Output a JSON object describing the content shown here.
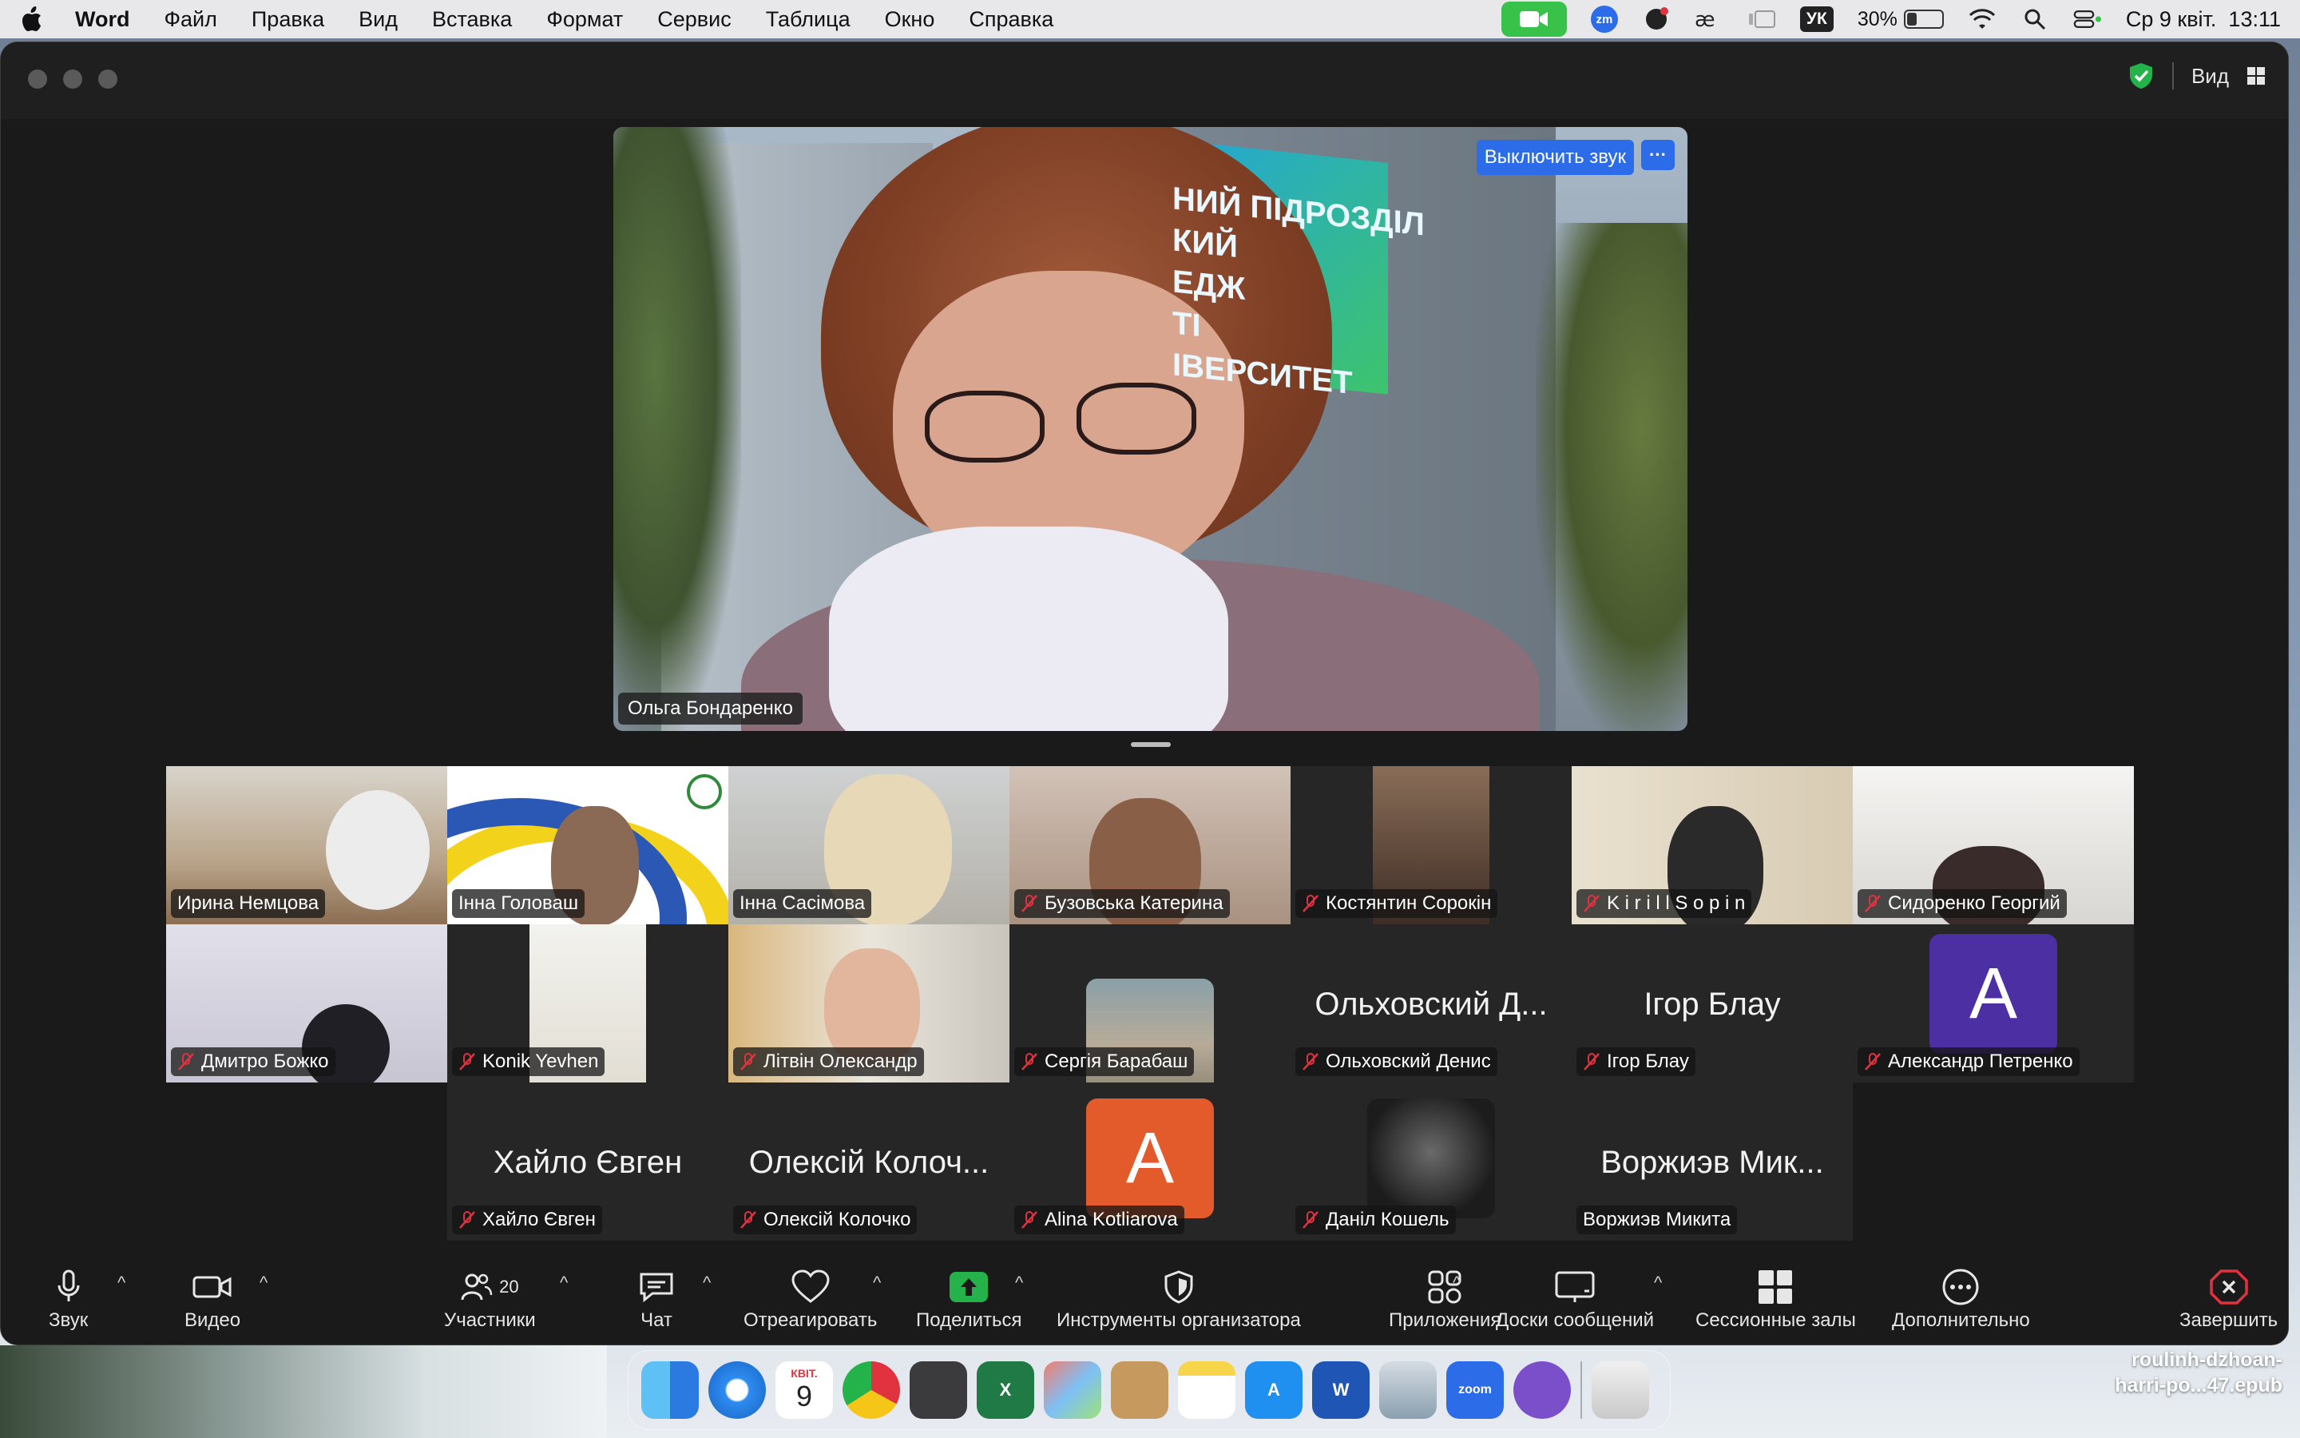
{
  "menubar": {
    "app": "Word",
    "items": [
      "Файл",
      "Правка",
      "Вид",
      "Вставка",
      "Формат",
      "Сервис",
      "Таблица",
      "Окно",
      "Справка"
    ],
    "zoom_badge": "zm",
    "lang": "УК",
    "battery": "30%",
    "battery_level": 0.3,
    "datetime": "Ср 9 квіт.  13:11"
  },
  "zoom": {
    "view_label": "Вид",
    "speaker": {
      "name": "Ольга Бондаренко",
      "mute_label": "Выключить звук",
      "more_label": "···",
      "sign_text": "НИЙ ПІДРОЗДІЛ\nКИЙ\nЕДЖ\nТІ\nІВЕРСИТЕТ"
    },
    "participants": [
      {
        "name": "Ирина Немцова",
        "muted": false
      },
      {
        "name": "Інна Головаш",
        "muted": false
      },
      {
        "name": "Інна Сасімова",
        "muted": false
      },
      {
        "name": "Бузовська Катерина",
        "muted": true
      },
      {
        "name": "Костянтин Сорокін",
        "muted": true
      },
      {
        "name": "K i r i l l  S o p i n",
        "muted": true
      },
      {
        "name": "Сидоренко Георгий",
        "muted": true
      },
      {
        "name": "Дмитро Божко",
        "muted": true
      },
      {
        "name": "Konik Yevhen",
        "muted": true
      },
      {
        "name": "Літвін Олександр",
        "muted": true
      },
      {
        "name": "Сергія Барабаш",
        "muted": true
      },
      {
        "name": "Ольховский Денис",
        "muted": true,
        "big": "Ольховский Д..."
      },
      {
        "name": "Ігор Блау",
        "muted": true,
        "big": "Ігор Блау"
      },
      {
        "name": "Александр Петренко",
        "muted": true,
        "avatar": "A"
      },
      {
        "name": "Хайло Євген",
        "muted": true,
        "big": "Хайло Євген"
      },
      {
        "name": "Олексій Колочко",
        "muted": true,
        "big": "Олексій Колоч..."
      },
      {
        "name": "Alina Kotliarova",
        "muted": true,
        "avatar": "A"
      },
      {
        "name": "Даніл Кошель",
        "muted": true
      },
      {
        "name": "Воржиэв Микита",
        "muted": false,
        "big": "Воржиэв Мик..."
      }
    ],
    "colors": {
      "accent": "#2d6ce8",
      "avatar_purple": "#4b2fa3",
      "avatar_orange": "#e35a2b",
      "leave_red": "#e0323f"
    },
    "toolbar": {
      "audio": "Звук",
      "video": "Видео",
      "participants": "Участники",
      "participants_count": "20",
      "chat": "Чат",
      "react": "Отреагировать",
      "share": "Поделиться",
      "host_tools": "Инструменты организатора",
      "apps": "Приложения",
      "whiteboards": "Доски сообщений",
      "breakout": "Сессионные залы",
      "more": "Дополнительно",
      "leave": "Завершить",
      "caret": "^"
    }
  },
  "dock": {
    "calendar_month": "КВІТ.",
    "calendar_day": "9",
    "zoom_label": "zoom",
    "apps": [
      "finder",
      "safari",
      "calendar",
      "chrome",
      "screenshot",
      "excel",
      "launchpad",
      "contacts",
      "notes",
      "app-store",
      "word",
      "preview",
      "zoom",
      "viber",
      "trash"
    ]
  },
  "desktop": {
    "file_line1": "roulinh-dzhoan-",
    "file_line2": "harri-po...47.epub"
  }
}
